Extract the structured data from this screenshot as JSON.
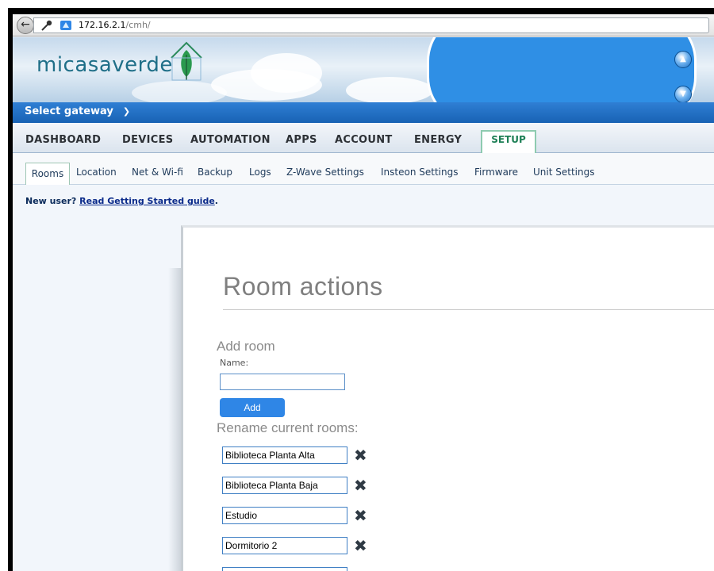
{
  "browser": {
    "url_host": "172.16.2.1",
    "url_path": "/cmh/"
  },
  "brand": {
    "logo_text": "micasaverde",
    "accent_blue": "#2f86e6",
    "accent_green": "#1d7f55"
  },
  "gateway": {
    "label": "Select gateway"
  },
  "main_tabs": [
    {
      "label": "DASHBOARD"
    },
    {
      "label": "DEVICES"
    },
    {
      "label": "AUTOMATION"
    },
    {
      "label": "APPS"
    },
    {
      "label": "ACCOUNT"
    },
    {
      "label": "ENERGY"
    },
    {
      "label": "SETUP",
      "active": true
    }
  ],
  "sub_tabs": [
    {
      "label": "Rooms",
      "active": true
    },
    {
      "label": "Location"
    },
    {
      "label": "Net & Wi-fi"
    },
    {
      "label": "Backup"
    },
    {
      "label": "Logs"
    },
    {
      "label": "Z-Wave Settings"
    },
    {
      "label": "Insteon Settings"
    },
    {
      "label": "Firmware"
    },
    {
      "label": "Unit Settings"
    }
  ],
  "notice": {
    "prefix": "New user?",
    "link": "Read Getting Started guide",
    "suffix": "."
  },
  "room_actions": {
    "title": "Room actions",
    "add_room_heading": "Add room",
    "name_label": "Name:",
    "name_value": "",
    "add_button": "Add",
    "rename_heading": "Rename current rooms:",
    "rooms": [
      "Biblioteca Planta Alta",
      "Biblioteca Planta Baja",
      "Estudio",
      "Dormitorio 2"
    ]
  }
}
